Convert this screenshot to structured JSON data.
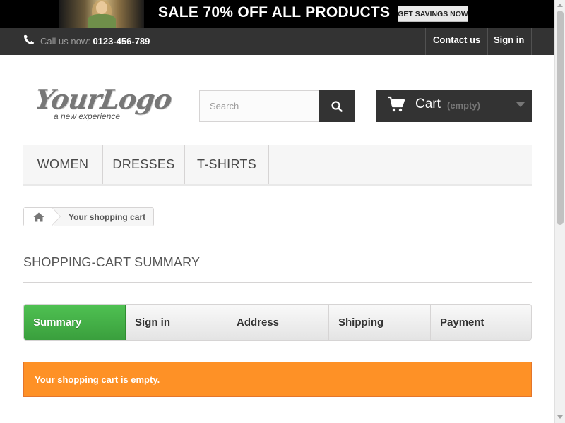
{
  "banner": {
    "headline": "SALE 70% OFF ALL PRODUCTS",
    "cta_label": "GET SAVINGS NOW"
  },
  "topnav": {
    "call_label": "Call us now:",
    "phone": "0123-456-789",
    "contact_label": "Contact us",
    "signin_label": "Sign in"
  },
  "logo": {
    "text": "YourLogo",
    "tagline": "a new experience"
  },
  "search": {
    "placeholder": "Search",
    "value": ""
  },
  "cart": {
    "label": "Cart",
    "status": "(empty)"
  },
  "menu": {
    "items": [
      {
        "label": "WOMEN"
      },
      {
        "label": "DRESSES"
      },
      {
        "label": "T-SHIRTS"
      }
    ]
  },
  "breadcrumb": {
    "current": "Your shopping cart"
  },
  "page": {
    "heading": "SHOPPING-CART SUMMARY"
  },
  "steps": {
    "items": [
      {
        "label": "Summary",
        "state": "current"
      },
      {
        "label": "Sign in",
        "state": "todo"
      },
      {
        "label": "Address",
        "state": "todo"
      },
      {
        "label": "Shipping",
        "state": "todo"
      },
      {
        "label": "Payment",
        "state": "todo"
      }
    ]
  },
  "alert": {
    "message": "Your shopping cart is empty."
  },
  "colors": {
    "dark_bar": "#333333",
    "step_current": "#46a74e",
    "alert_warning": "#fe9126"
  },
  "icons": {
    "phone": "phone-icon",
    "search": "search-icon",
    "cart": "shopping-cart-icon",
    "home": "home-icon",
    "caret": "caret-down-icon"
  }
}
